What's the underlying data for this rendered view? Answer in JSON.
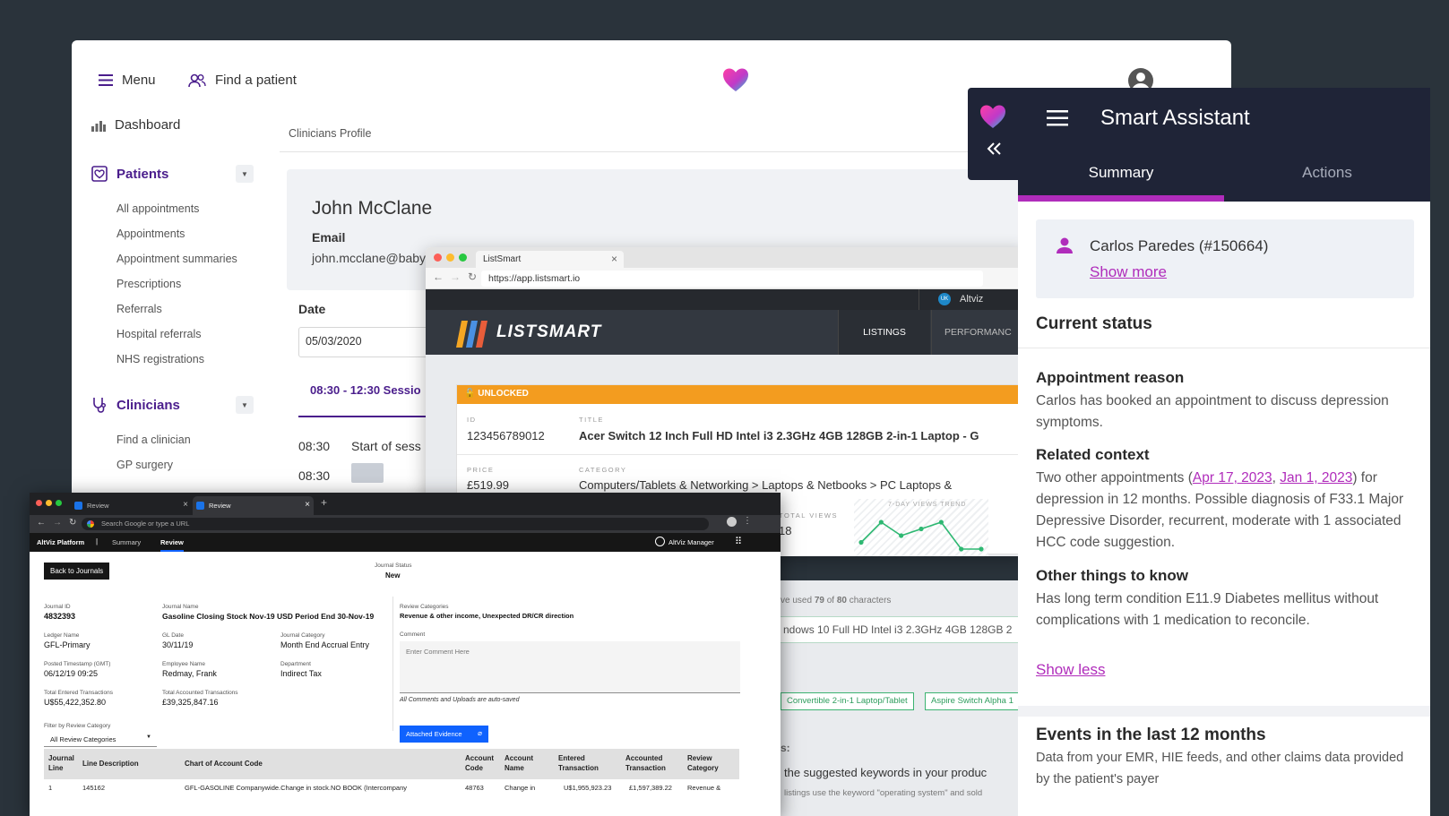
{
  "clinician_app": {
    "menu_label": "Menu",
    "find_patient_label": "Find a patient",
    "dashboard_label": "Dashboard",
    "patients_label": "Patients",
    "patients_sub": [
      "All appointments",
      "Appointments",
      "Appointment summaries",
      "Prescriptions",
      "Referrals",
      "Hospital referrals",
      "NHS registrations"
    ],
    "clinicians_label": "Clinicians",
    "clinicians_sub": [
      "Find a clinician",
      "GP surgery"
    ],
    "breadcrumb": "Clinicians Profile",
    "profile_name": "John McClane",
    "email_label": "Email",
    "email_value": "john.mcclane@baby",
    "date_label": "Date",
    "date_value": "05/03/2020",
    "session_tab": "08:30 - 12:30 Sessio",
    "time_first": "08:30",
    "start_label": "Start of sess",
    "time_second": "08:30"
  },
  "listsmart": {
    "tab_title": "ListSmart",
    "url": "https://app.listsmart.io",
    "account_badge": "UK",
    "account_name": "Altviz",
    "logo_text": "LISTSMART",
    "nav_listings": "LISTINGS",
    "nav_performance": "PERFORMANC",
    "unlocked_label": "UNLOCKED",
    "id_label": "ID",
    "id_value": "123456789012",
    "title_label": "TITLE",
    "title_value": "Acer Switch 12 Inch Full HD Intel i3 2.3GHz 4GB 128GB 2-in-1 Laptop - G",
    "price_label": "PRICE",
    "price_value": "£519.99",
    "category_label": "CATEGORY",
    "category_value": "Computers/Tablets & Networking > Laptops & Netbooks > PC Laptops &",
    "total_views_label": "TOTAL VIEWS",
    "total_views_value": "18",
    "trend_label": "7-DAY VIEWS TREND",
    "trend_values": [
      2,
      5,
      3,
      4,
      5,
      1,
      1
    ],
    "chars_prefix": "ve used ",
    "chars_used": "79",
    "chars_mid": " of ",
    "chars_max": "80",
    "chars_suffix": " characters",
    "title_input": "ndows 10 Full HD Intel i3 2.3GHz 4GB 128GB 2",
    "tag1": "Convertible 2-in-1 Laptop/Tablet",
    "tag2": "Aspire Switch Alpha 1",
    "keywords_colon": "s:",
    "keywords_text": "the suggested keywords in your produc",
    "keywords_small": "listings use the keyword \"operating system\" and sold"
  },
  "smart_assistant": {
    "title": "Smart Assistant",
    "tab_summary": "Summary",
    "tab_actions": "Actions",
    "patient_name": "Carlos Paredes (#150664)",
    "show_more": "Show more",
    "current_status": "Current status",
    "appt_reason_title": "Appointment reason",
    "appt_reason_text": "Carlos has booked an appointment to discuss depression symptoms.",
    "related_title": "Related context",
    "related_pre": "Two other appointments (",
    "related_link1": "Apr 17, 2023",
    "related_sep": ", ",
    "related_link2": "Jan 1, 2023",
    "related_post": ") for depression in 12 months. Possible diagnosis of F33.1 Major Depressive Disorder, recurrent, moderate with 1 associated HCC code suggestion.",
    "other_title": "Other things to know",
    "other_text": "Has long term condition E11.9 Diabetes mellitus without complications with 1 medication to reconcile.",
    "show_less": "Show less",
    "events_title": "Events in the last 12 months",
    "events_text": "Data from your EMR, HIE feeds, and other claims data provided by the patient's payer",
    "colors": {
      "accent": "#b02cbb",
      "header": "#1f2437"
    }
  },
  "review": {
    "tab1": "Review",
    "tab2": "Review",
    "omnibox": "Search Google or type a URL",
    "brand": "AltViz Platform",
    "nav_summary": "Summary",
    "nav_review": "Review",
    "user": "AltViz Manager",
    "back_btn": "Back to Journals",
    "status_label": "Journal Status",
    "status_value": "New",
    "journal_id_label": "Journal ID",
    "journal_id": "4832393",
    "journal_name_label": "Journal Name",
    "journal_name": "Gasoline Closing Stock Nov-19 USD Period End 30-Nov-19",
    "ledger_label": "Ledger Name",
    "ledger": "GFL-Primary",
    "gl_date_label": "GL Date",
    "gl_date": "30/11/19",
    "journal_cat_label": "Journal Category",
    "journal_cat": "Month End Accrual Entry",
    "posted_label": "Posted Timestamp (GMT)",
    "posted": "06/12/19 09:25",
    "employee_label": "Employee Name",
    "employee": "Redmay, Frank",
    "dept_label": "Department",
    "dept": "Indirect Tax",
    "total_entered_label": "Total Entered Transactions",
    "total_entered": "U$55,422,352.80",
    "total_accounted_label": "Total Accounted Transactions",
    "total_accounted": "£39,325,847.16",
    "review_cats_label": "Review Categories",
    "review_cats": "Revenue & other income, Unexpected DR/CR direction",
    "comment_label": "Comment",
    "comment_placeholder": "Enter Comment Here",
    "autosave_note": "All Comments and Uploads are auto-saved",
    "filter_label": "Filter by Review Category",
    "filter_value": "All Review Categories",
    "attached_btn": "Attached Evidence",
    "table_headers": [
      "Journal Line",
      "Line Description",
      "Chart of Account Code",
      "Account Code",
      "Account Name",
      "Entered Transaction",
      "Accounted Transaction",
      "Review Category"
    ],
    "row": [
      "1",
      "145162",
      "GFL-GASOLINE Companywide.Change in stock.NO BOOK (Intercompany",
      "48763",
      "Change in",
      "U$1,955,923.23",
      "£1,597,389.22",
      "Revenue &"
    ]
  }
}
